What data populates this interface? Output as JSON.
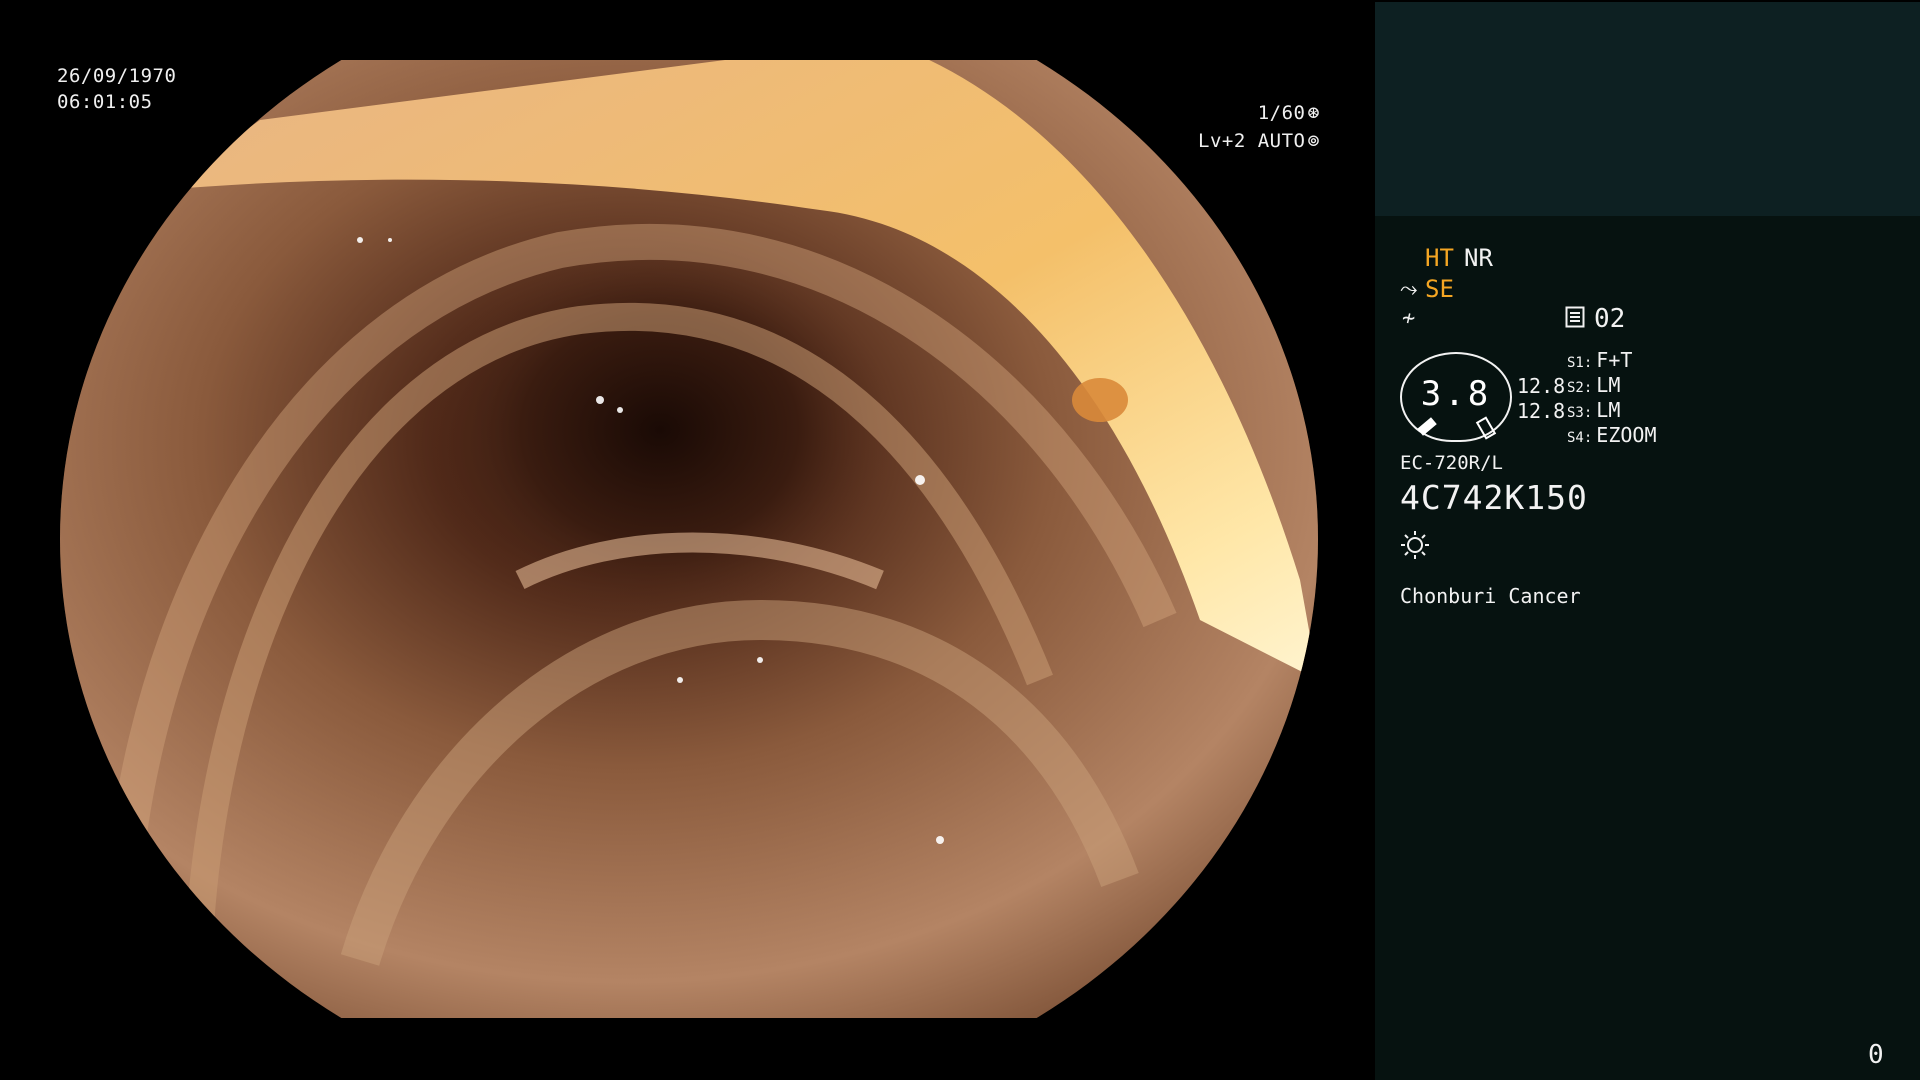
{
  "image_overlay": {
    "date": "26/09/1970",
    "time": "06:01:05",
    "shutter": "1/60",
    "shutter_icon": "aperture-icon",
    "level": "Lv+2 AUTO",
    "level_icon": "iris-icon"
  },
  "info_panel": {
    "ht": "HT",
    "nr": "NR",
    "se": "SE",
    "se_icon": "structure-enhance-icon",
    "enhance_icon": "enhance-icon",
    "channel_icon": "memory-chip-icon",
    "channel": "02",
    "dial_value": "3.8",
    "dial_side_1": "12.8",
    "dial_side_2": "12.8",
    "switches": [
      {
        "key": "S1:",
        "value": "F+T"
      },
      {
        "key": "S2:",
        "value": "LM"
      },
      {
        "key": "S3:",
        "value": "LM"
      },
      {
        "key": "S4:",
        "value": "EZOOM"
      }
    ],
    "scope_model": "EC-720R/L",
    "scope_serial": "4C742K150",
    "light_icon": "light-source-icon",
    "hospital": "Chonburi Cancer",
    "counter": "0"
  },
  "colors": {
    "panel_top": "#0d2022",
    "panel_bottom": "#061210",
    "accent_orange": "#f5a623",
    "text": "#f2f2f2"
  }
}
